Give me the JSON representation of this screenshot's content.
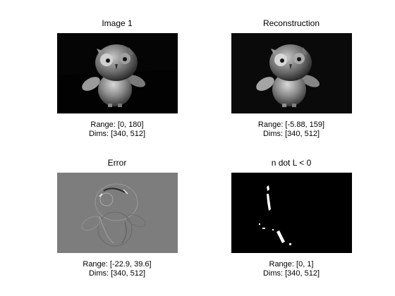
{
  "figure": {
    "panels": [
      {
        "title": "Image 1",
        "range": "Range: [0, 180]",
        "dims": "Dims: [340, 512]"
      },
      {
        "title": "Reconstruction",
        "range": "Range: [-5.88, 159]",
        "dims": "Dims: [340, 512]"
      },
      {
        "title": "Error",
        "range": "Range: [-22.9, 39.6]",
        "dims": "Dims: [340, 512]"
      },
      {
        "title": "n dot L < 0",
        "range": "Range: [0, 1]",
        "dims": "Dims: [340, 512]"
      }
    ]
  }
}
